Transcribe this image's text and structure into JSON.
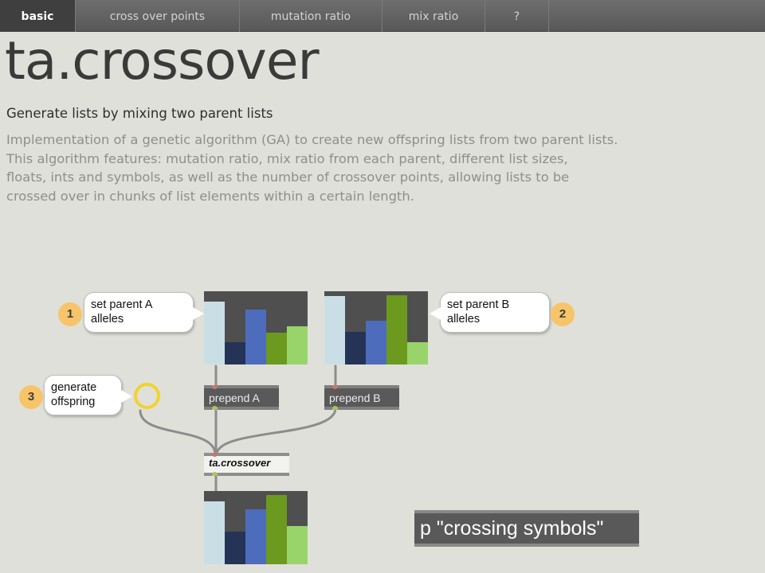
{
  "tabs": [
    {
      "label": "basic",
      "active": true
    },
    {
      "label": "cross over points",
      "active": false
    },
    {
      "label": "mutation ratio",
      "active": false
    },
    {
      "label": "mix ratio",
      "active": false
    },
    {
      "label": "?",
      "active": false
    }
  ],
  "header": {
    "title": "ta.crossover",
    "subtitle": "Generate lists by mixing two parent lists",
    "description_lines": [
      "Implementation of a genetic algorithm (GA) to create new offspring lists from two parent lists.",
      "This algorithm features: mutation ratio, mix ratio from each parent, different list sizes,",
      "floats, ints and symbols, as well as the number of crossover points, allowing lists to be",
      "crossed over in chunks of list elements within a certain length."
    ]
  },
  "patch": {
    "callouts": {
      "parent_a": {
        "number": "1",
        "lines": [
          "set parent A",
          "alleles"
        ]
      },
      "parent_b": {
        "number": "2",
        "lines": [
          "set parent B",
          "alleles"
        ]
      },
      "generate": {
        "number": "3",
        "lines": [
          "generate",
          "offspring"
        ]
      }
    },
    "messages": {
      "prepend_a": "prepend A",
      "prepend_b": "prepend B",
      "crossover_object": "ta.crossover",
      "subpatcher": "p \"crossing symbols\""
    },
    "multislider_range": [
      0,
      1
    ],
    "parent_a_values": [
      0.86,
      0.3,
      0.75,
      0.43,
      0.52
    ],
    "parent_b_values": [
      0.93,
      0.45,
      0.6,
      0.95,
      0.3
    ],
    "offspring_values": [
      0.86,
      0.45,
      0.75,
      0.95,
      0.52
    ],
    "bar_colors": [
      "#c9dfe5",
      "#243356",
      "#4e6cbc",
      "#6c9a1e",
      "#98d46a"
    ]
  },
  "colors": {
    "background": "#e0e0da",
    "tab_bar": "#666666",
    "tab_active": "#3f3f3f",
    "badge": "#f7c46a",
    "bang_ring": "#f2d22e",
    "object_box": "#595959"
  }
}
